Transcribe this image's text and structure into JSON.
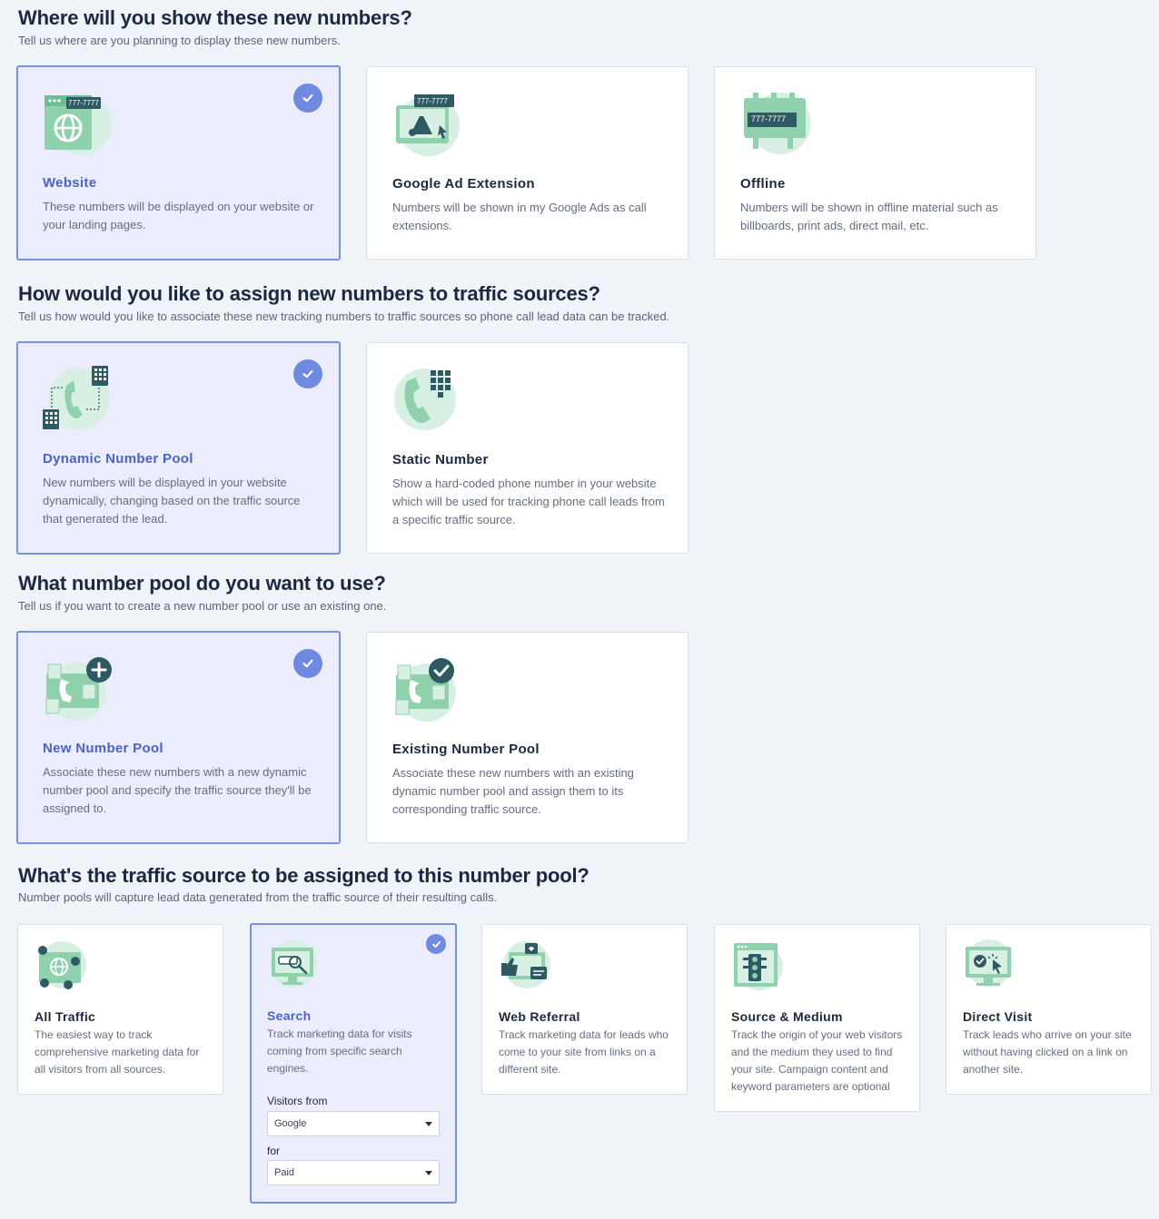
{
  "sections": [
    {
      "title": "Where will you show these new numbers?",
      "subtitle": "Tell us where are you planning to display these new numbers.",
      "options": [
        {
          "title": "Website",
          "description": "These numbers will be displayed on your website or your landing pages.",
          "selected": true,
          "icon": "website-phone-icon",
          "badge": "777-7777"
        },
        {
          "title": "Google Ad Extension",
          "description": "Numbers will be shown in my Google Ads as call extensions.",
          "selected": false,
          "icon": "google-ads-icon",
          "badge": "777-7777"
        },
        {
          "title": "Offline",
          "description": "Numbers will be shown in offline material such as billboards, print ads, direct mail, etc.",
          "selected": false,
          "icon": "billboard-icon",
          "badge": "777-7777"
        }
      ]
    },
    {
      "title": "How would you like to assign new numbers to traffic sources?",
      "subtitle": "Tell us how would you like to associate these new tracking numbers to traffic sources so phone call lead data can be tracked.",
      "options": [
        {
          "title": "Dynamic Number Pool",
          "description": "New numbers will be displayed in your website dynamically, changing based on the traffic source that generated the lead.",
          "selected": true,
          "icon": "dynamic-pool-icon"
        },
        {
          "title": "Static Number",
          "description": "Show a hard-coded phone number in your website which will be used for tracking phone call leads from a specific traffic source.",
          "selected": false,
          "icon": "static-number-icon"
        }
      ]
    },
    {
      "title": "What number pool do you want to use?",
      "subtitle": "Tell us if you want to create a new number pool or use an existing one.",
      "options": [
        {
          "title": "New Number Pool",
          "description": "Associate these new numbers with a new dynamic number pool and specify the traffic source they'll be assigned to.",
          "selected": true,
          "icon": "new-pool-icon"
        },
        {
          "title": "Existing Number Pool",
          "description": "Associate these new numbers with an existing dynamic number pool and assign them to its corresponding traffic source.",
          "selected": false,
          "icon": "existing-pool-icon"
        }
      ]
    },
    {
      "title": "What's the traffic source to be assigned to this number pool?",
      "subtitle": "Number pools will capture lead data generated from the traffic source of their resulting calls.",
      "options": [
        {
          "title": "All Traffic",
          "description": "The easiest way to track comprehensive marketing data for all visitors from all sources.",
          "selected": false,
          "icon": "all-traffic-icon"
        },
        {
          "title": "Search",
          "description": "Track marketing data for visits coming from specific search engines.",
          "selected": true,
          "icon": "search-monitor-icon"
        },
        {
          "title": "Web Referral",
          "description": "Track marketing data for leads who come to your site from links on a different site.",
          "selected": false,
          "icon": "web-referral-icon"
        },
        {
          "title": "Source & Medium",
          "description": "Track the origin of your web visitors and the medium they used to find your site. Campaign content and keyword parameters are optional",
          "selected": false,
          "icon": "source-medium-icon"
        },
        {
          "title": "Direct Visit",
          "description": "Track leads who arrive on your site without having clicked on a link on another site.",
          "selected": false,
          "icon": "direct-visit-icon"
        }
      ],
      "search_filters": {
        "visitors_from_label": "Visitors from",
        "visitors_from_value": "Google",
        "for_label": "for",
        "for_value": "Paid"
      }
    }
  ],
  "colors": {
    "page_bg": "#f0f4f9",
    "selected_bg": "#ecedfc",
    "selected_border": "#7b8fdf",
    "check_bg": "#6f89e0",
    "illustration_mint": "#d8efe4",
    "illustration_green": "#8fd0ad",
    "illustration_dark": "#2f5a63"
  }
}
